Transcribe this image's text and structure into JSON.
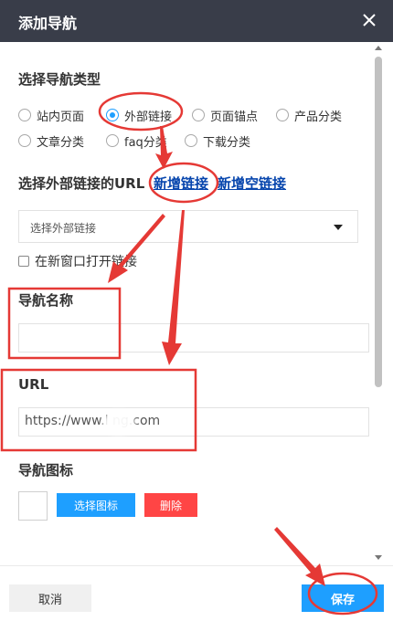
{
  "dialog": {
    "title": "添加导航",
    "close_icon": "close-icon"
  },
  "nav_type": {
    "label": "选择导航类型",
    "options": [
      "站内页面",
      "外部链接",
      "页面锚点",
      "产品分类",
      "文章分类",
      "faq分类",
      "下载分类"
    ],
    "selected": "外部链接"
  },
  "external_url": {
    "label": "选择外部链接的URL",
    "add_link": "新增链接",
    "add_empty_link": "新增空链接",
    "select_value": "选择外部链接",
    "open_new_window": "在新窗口打开链接"
  },
  "nav_name": {
    "label": "导航名称",
    "value": ""
  },
  "url": {
    "label": "URL",
    "value": "https://www.l      ng.com"
  },
  "nav_icon": {
    "label": "导航图标",
    "choose_button": "选择图标",
    "delete_button": "删除"
  },
  "footer": {
    "cancel": "取消",
    "save": "保存"
  },
  "colors": {
    "header_bg": "#393d49",
    "primary": "#1e9fff",
    "danger": "#ff4545",
    "annotation": "#e53935"
  }
}
